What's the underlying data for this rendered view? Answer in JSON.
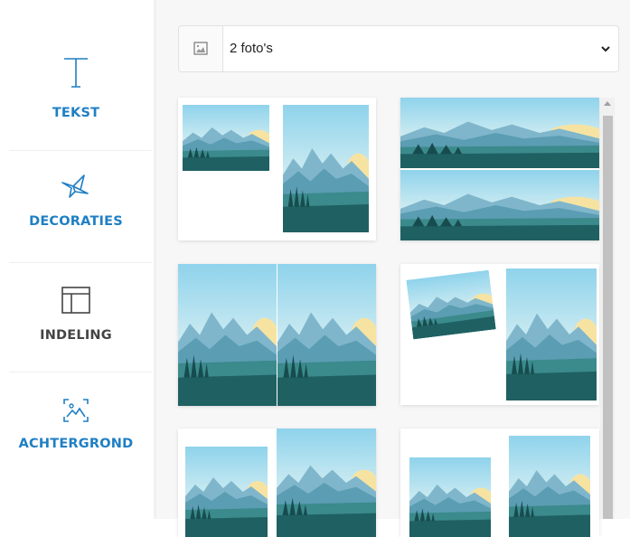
{
  "sidebar": {
    "items": [
      {
        "label": "TEKST",
        "icon": "text-icon",
        "color": "#1f7fc4"
      },
      {
        "label": "DECORATIES",
        "icon": "origami-bird-icon",
        "color": "#1f7fc4"
      },
      {
        "label": "INDELING",
        "icon": "layout-icon",
        "color": "#444444"
      },
      {
        "label": "ACHTERGROND",
        "icon": "background-image-icon",
        "color": "#1f7fc4"
      }
    ]
  },
  "photo_select": {
    "icon": "image-icon",
    "value": "2 foto's",
    "options": [
      "2 foto's"
    ]
  },
  "layouts": [
    {
      "name": "layout-1",
      "photos": 2
    },
    {
      "name": "layout-2",
      "photos": 2
    },
    {
      "name": "layout-3",
      "photos": 2
    },
    {
      "name": "layout-4",
      "photos": 2
    },
    {
      "name": "layout-5",
      "photos": 2
    },
    {
      "name": "layout-6",
      "photos": 2
    }
  ],
  "colors": {
    "accent": "#1f7fc4",
    "sky_top": "#a9dff2",
    "sun": "#f6e3a4",
    "mountain": "#6aa8bf",
    "hill": "#3f8a8f",
    "forest": "#1e5f63"
  }
}
